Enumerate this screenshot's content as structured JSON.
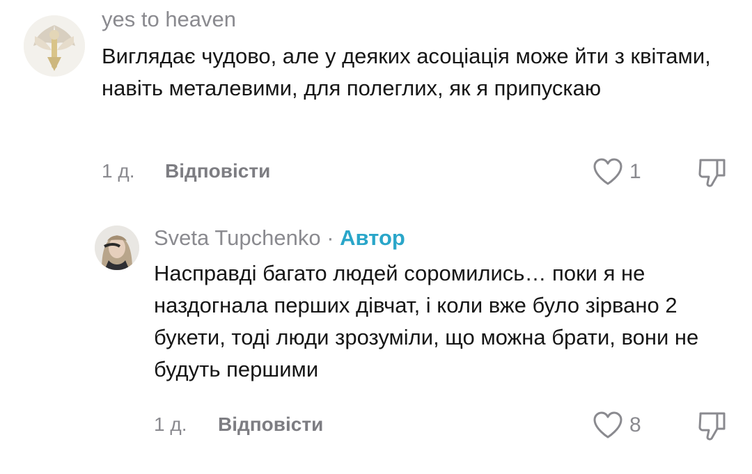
{
  "comments": [
    {
      "username": "yes to heaven",
      "text": "Виглядає чудово, але у деяких асоціація може йти з квітами, навіть металевими, для полеглих, як я припускаю",
      "time": "1 д.",
      "reply_label": "Відповісти",
      "likes": "1"
    },
    {
      "username": "Sveta Tupchenko",
      "separator": "·",
      "author_badge": "Автор",
      "text": "Насправді багато людей соромились… поки я не наздогнала перших дівчат, і коли вже було зірвано 2 букети, тоді люди зрозуміли, що можна брати, вони не будуть першими",
      "time": "1 д.",
      "reply_label": "Відповісти",
      "likes": "8"
    }
  ],
  "icons": {
    "like": "heart-outline-icon",
    "dislike": "thumbs-down-outline-icon"
  },
  "colors": {
    "author_accent": "#2aa6c9",
    "secondary_text": "#8a8a8f",
    "primary_text": "#161616"
  }
}
